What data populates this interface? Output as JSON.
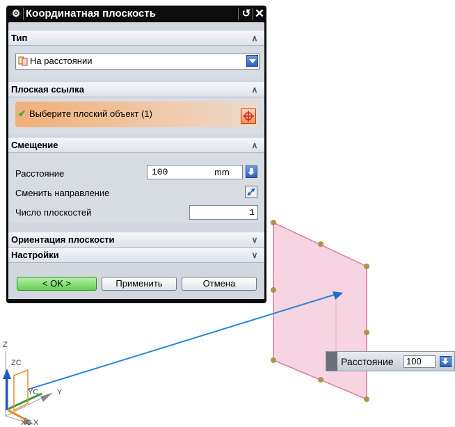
{
  "dialog": {
    "title": "Координатная плоскость",
    "sections": {
      "type": {
        "header": "Тип",
        "value": "На расстоянии"
      },
      "planar_ref": {
        "header": "Плоская ссылка",
        "selection_label": "Выберите плоский объект (1)"
      },
      "offset": {
        "header": "Смещение",
        "distance_label": "Расстояние",
        "distance_value": "100",
        "distance_unit": "mm",
        "reverse_label": "Сменить направление",
        "count_label": "Число плоскостей",
        "count_value": "1"
      },
      "orientation": {
        "header": "Ориентация плоскости"
      },
      "settings": {
        "header": "Настройки"
      }
    },
    "buttons": {
      "ok": "< OK >",
      "apply": "Применить",
      "cancel": "Отмена"
    }
  },
  "graphics": {
    "onscreen_input": {
      "label": "Расстояние",
      "value": "100"
    },
    "triad": {
      "z": "Z",
      "zc": "ZC",
      "yc": "YC",
      "y": "Y",
      "xc": "XC",
      "x": "X"
    }
  },
  "colors": {
    "plane_fill": "#f6d4e2",
    "plane_edge": "#d97aa6",
    "handle": "#b09445",
    "vector": "#2a86d8"
  }
}
